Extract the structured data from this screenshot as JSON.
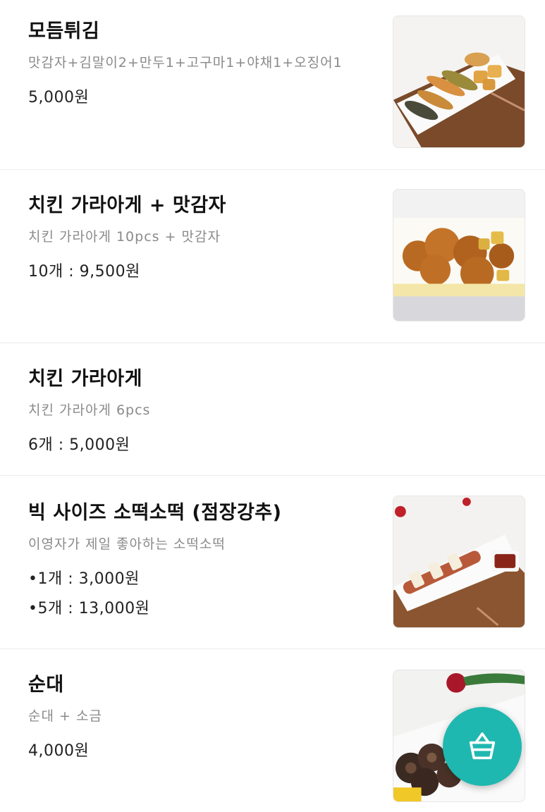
{
  "menu": {
    "items": [
      {
        "name": "모듬튀김",
        "description": "맛감자+김말이2+만두1+고구마1+야채1+오징어1",
        "prices": [
          "5,000원"
        ],
        "image": "assorted-fries-photo"
      },
      {
        "name": "치킨 가라아게 + 맛감자",
        "description": "치킨 가라아게 10pcs + 맛감자",
        "prices": [
          "10개 : 9,500원"
        ],
        "image": "chicken-karaage-potato-photo"
      },
      {
        "name": "치킨 가라아게",
        "description": "치킨 가라아게 6pcs",
        "prices": [
          "6개 : 5,000원"
        ],
        "image": null
      },
      {
        "name": "빅 사이즈 소떡소떡 (점장강추)",
        "description": "이영자가 제일 좋아하는 소떡소떡",
        "prices": [
          "•1개 : 3,000원",
          "•5개 : 13,000원"
        ],
        "image": "sotteok-skewer-photo"
      },
      {
        "name": "순대",
        "description": "순대 + 소금",
        "prices": [
          "4,000원"
        ],
        "image": "sundae-photo"
      }
    ]
  },
  "cart_button": {
    "icon": "basket-icon",
    "color": "#1fb8b0"
  }
}
